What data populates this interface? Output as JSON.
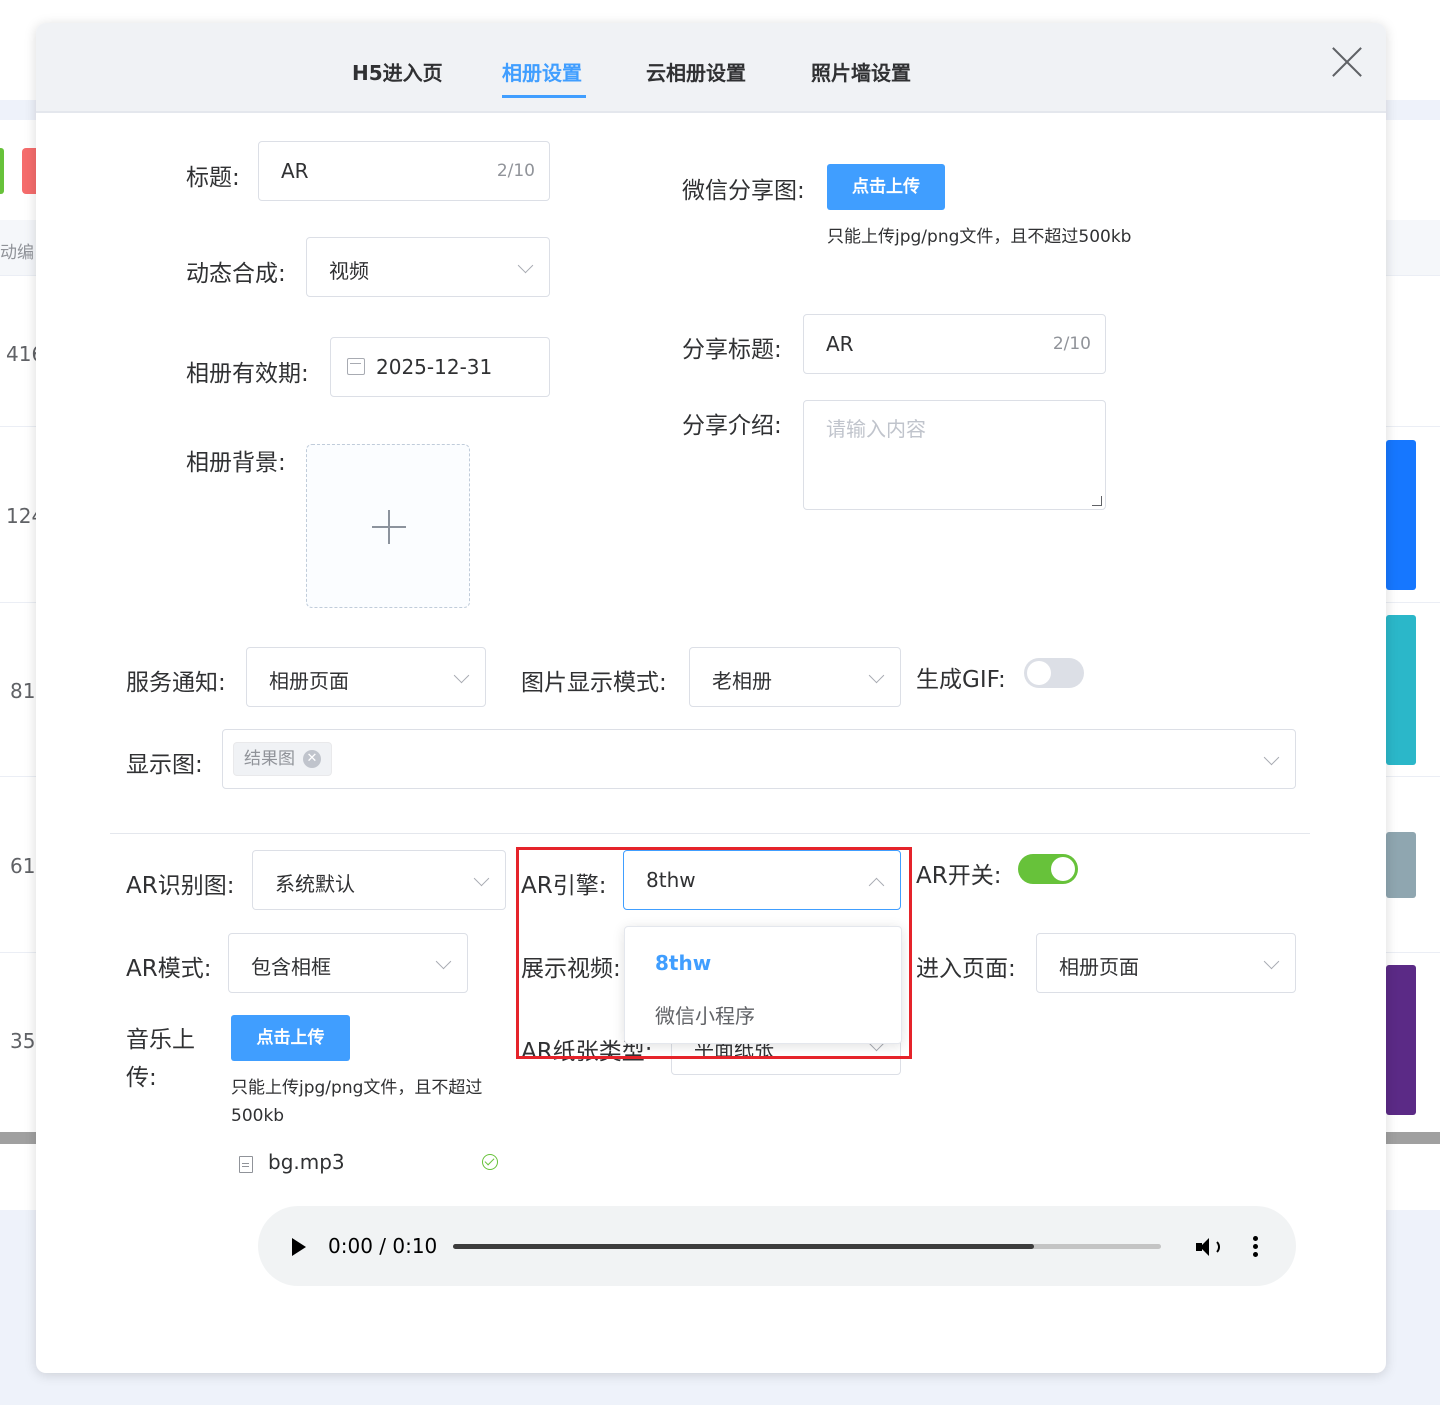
{
  "background": {
    "header_fragment": "动编",
    "row_numbers": [
      "416",
      "124",
      "81",
      "61",
      "35"
    ]
  },
  "tabs": [
    {
      "label": "H5进入页",
      "active": false
    },
    {
      "label": "相册设置",
      "active": true
    },
    {
      "label": "云相册设置",
      "active": false
    },
    {
      "label": "照片墙设置",
      "active": false
    }
  ],
  "form": {
    "title": {
      "label": "标题:",
      "value": "AR",
      "count": "2/10"
    },
    "dynamic": {
      "label": "动态合成:",
      "value": "视频"
    },
    "validity": {
      "label": "相册有效期:",
      "value": "2025-12-31"
    },
    "background": {
      "label": "相册背景:"
    },
    "wechat_share": {
      "label": "微信分享图:",
      "button": "点击上传",
      "hint": "只能上传jpg/png文件，且不超过500kb"
    },
    "share_title": {
      "label": "分享标题:",
      "value": "AR",
      "count": "2/10"
    },
    "share_intro": {
      "label": "分享介绍:",
      "placeholder": "请输入内容"
    },
    "service_notice": {
      "label": "服务通知:",
      "value": "相册页面"
    },
    "display_mode": {
      "label": "图片显示模式:",
      "value": "老相册"
    },
    "gif": {
      "label": "生成GIF:",
      "on": false
    },
    "display_image": {
      "label": "显示图:",
      "tag": "结果图"
    },
    "ar_image": {
      "label": "AR识别图:",
      "value": "系统默认"
    },
    "ar_engine": {
      "label": "AR引擎:",
      "value": "8thw",
      "options": [
        "8thw",
        "微信小程序"
      ]
    },
    "ar_switch": {
      "label": "AR开关:",
      "on": true
    },
    "ar_mode": {
      "label": "AR模式:",
      "value": "包含相框"
    },
    "show_video": {
      "label": "展示视频:"
    },
    "enter_page": {
      "label": "进入页面:",
      "value": "相册页面"
    },
    "ar_paper": {
      "label": "AR纸张类型:",
      "value": "平面纸张"
    },
    "music": {
      "label_line1": "音乐上",
      "label_line2": "传:",
      "button": "点击上传",
      "hint_line1": "只能上传jpg/png文件，且不超过",
      "hint_line2": "500kb",
      "file": "bg.mp3"
    },
    "audio": {
      "time": "0:00 / 0:10",
      "progress": 0.82
    }
  },
  "colors": {
    "primary": "#409eff",
    "switch_on": "#67c23a",
    "highlight": "#e5232a"
  }
}
